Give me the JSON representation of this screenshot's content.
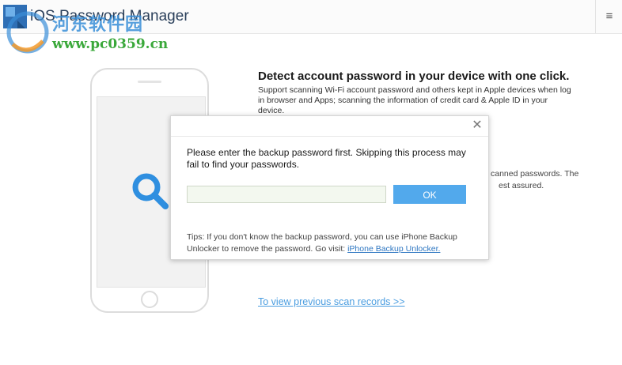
{
  "app": {
    "title": "iOS Password Manager",
    "menu_icon": "hamburger-menu-icon",
    "menu_glyph": "≡"
  },
  "watermark": {
    "site_name": "河东软件园",
    "url": "www.pc0359.cn"
  },
  "main": {
    "headline": "Detect account password in your device with one click.",
    "description": "Support scanning Wi-Fi account password and others kept in Apple devices when log in browser and Apps; scanning the information of credit card & Apple ID in your device.",
    "partial_line_1": "canned passwords. The",
    "partial_line_2": "est assured.",
    "view_records_link": "To view previous scan records >>"
  },
  "dialog": {
    "close_glyph": "✕",
    "message": "Please enter the backup password first. Skipping this process may fail to find your passwords.",
    "password_value": "",
    "ok_label": "OK",
    "tips_text": "Tips: If you don't know the backup password, you can use iPhone Backup Unlocker to remove the password. Go visit: ",
    "tips_link": "iPhone Backup Unlocker."
  },
  "colors": {
    "accent": "#52a9ec",
    "link": "#4a9de0",
    "magnifier": "#2f8fe0"
  }
}
